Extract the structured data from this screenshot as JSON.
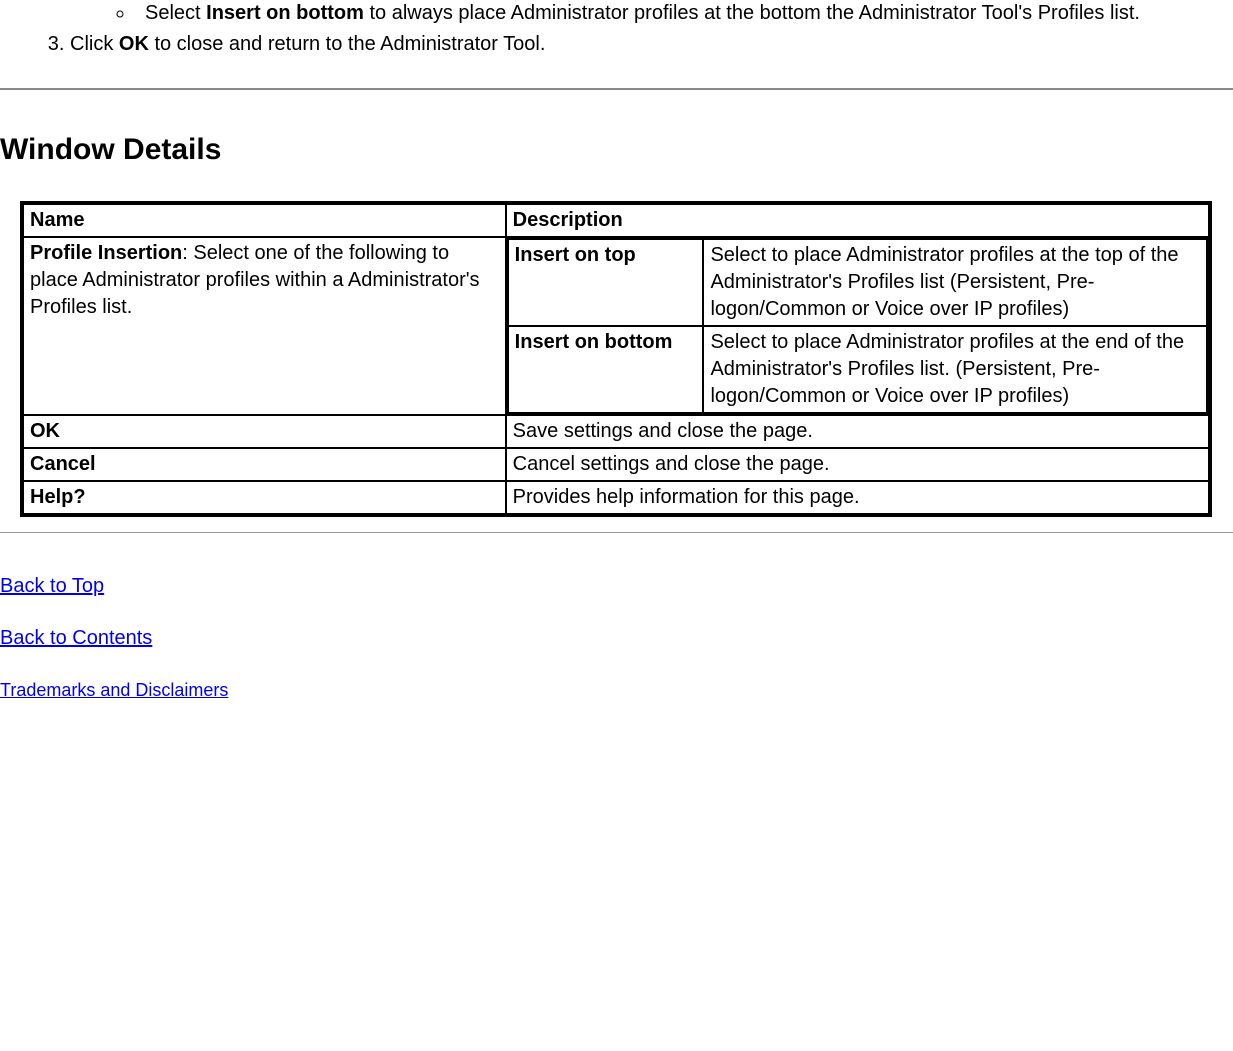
{
  "list": {
    "sub_item_prefix": "Select ",
    "sub_item_bold": "Insert on bottom",
    "sub_item_suffix": " to always place Administrator profiles at the bottom the Administrator Tool's Profiles list.",
    "step3_prefix": "Click ",
    "step3_bold": "OK",
    "step3_suffix": " to close and return to the Administrator Tool."
  },
  "heading": "Window Details",
  "table": {
    "header_name": "Name",
    "header_desc": "Description",
    "row1": {
      "name_bold": "Profile Insertion",
      "name_rest": ": Select one of the following to place Administrator profiles within a Administrator's Profiles list.",
      "opt1_name": "Insert on top",
      "opt1_desc": "Select to place Administrator profiles at the top of the Administrator's Profiles list (Persistent, Pre-logon/Common or Voice over IP profiles)",
      "opt2_name": "Insert on bottom",
      "opt2_desc": "Select to place Administrator profiles at the end of the Administrator's Profiles list. (Persistent, Pre-logon/Common or Voice over IP profiles)"
    },
    "row_ok_name": "OK",
    "row_ok_desc": "Save settings and close the page.",
    "row_cancel_name": "Cancel",
    "row_cancel_desc": "Cancel settings and close the page.",
    "row_help_name": "Help?",
    "row_help_desc": "Provides help information for this page."
  },
  "links": {
    "back_top": "Back to Top",
    "back_contents": "Back to Contents",
    "trademarks": "Trademarks and Disclaimers"
  }
}
